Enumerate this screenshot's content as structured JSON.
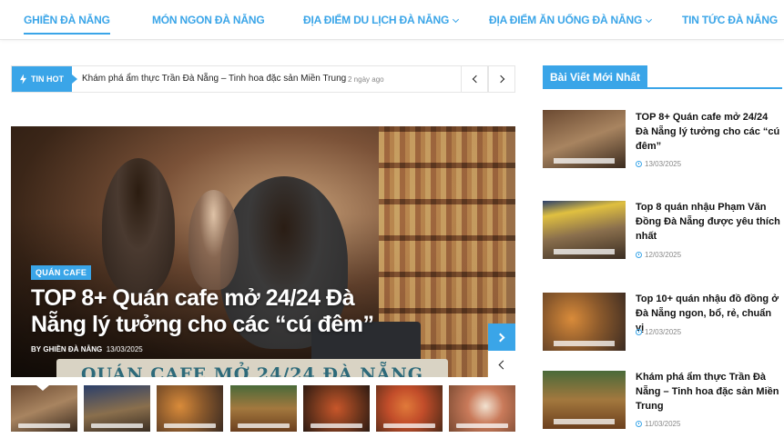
{
  "nav": {
    "items": [
      {
        "label": "GHIỀN ĐÀ NẴNG",
        "active": true
      },
      {
        "label": "MÓN NGON ĐÀ NẴNG"
      },
      {
        "label": "ĐỊA ĐIỂM DU LỊCH ĐÀ NẴNG",
        "dropdown": true
      },
      {
        "label": "ĐỊA ĐIỂM ĂN UỐNG ĐÀ NẴNG",
        "dropdown": true
      },
      {
        "label": "TIN TỨC ĐÀ NẴNG"
      }
    ]
  },
  "ticker": {
    "label": "TIN HOT",
    "headline": "Khám phá ẩm thực Trần Đà Nẵng – Tinh hoa đặc sản Miền Trung",
    "time": "2 ngày ago",
    "icon": "bolt-icon"
  },
  "hero": {
    "category": "QUÁN CAFE",
    "title": "TOP 8+ Quán cafe mở 24/24 Đà Nẵng lý tưởng cho các “cú đêm”",
    "by_prefix": "BY",
    "author": "GHIỀN ĐÀ NẴNG",
    "date": "13/03/2025",
    "image_text": "QUÁN CAFE MỞ 24/24 ĐÀ NẴNG"
  },
  "thumbnails_count": 7,
  "sidebar": {
    "heading": "Bài Viết Mới Nhất",
    "posts": [
      {
        "title": "TOP 8+ Quán cafe mở 24/24 Đà Nẵng lý tưởng cho các “cú đêm”",
        "date": "13/03/2025"
      },
      {
        "title": "Top 8 quán nhậu Phạm Văn Đồng Đà Nẵng được yêu thích nhất",
        "date": "12/03/2025"
      },
      {
        "title": "Top 10+ quán nhậu đồ đồng ở Đà Nẵng ngon, bổ, rẻ, chuẩn vị",
        "date": "12/03/2025"
      },
      {
        "title": "Khám phá ẩm thực Trần Đà Nẵng – Tinh hoa đặc sản Miền Trung",
        "date": "11/03/2025"
      }
    ]
  },
  "colors": {
    "accent": "#3aa5e8"
  }
}
